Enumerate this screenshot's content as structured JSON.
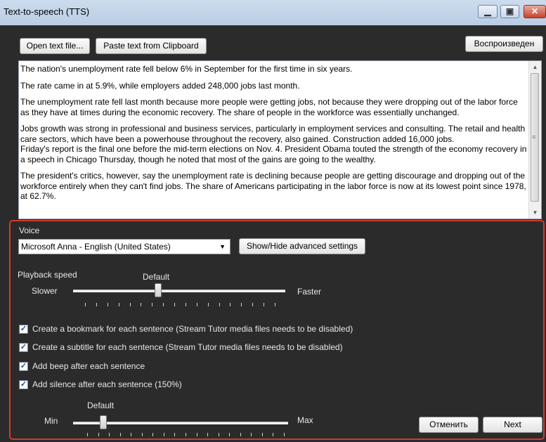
{
  "window": {
    "title": "Text-to-speech (TTS)",
    "min_glyph": "▁",
    "max_glyph": "▣",
    "close_glyph": "✕"
  },
  "toolbar": {
    "open_label": "Open text file...",
    "paste_label": "Paste text from Clipboard",
    "play_label": "Воспроизведен"
  },
  "text": {
    "paragraphs": [
      "The nation's unemployment rate fell below 6% in September for the first time in six years.",
      "The rate came in at 5.9%, while employers added 248,000 jobs last month.",
      "The unemployment rate fell last month because more people were getting jobs, not because they were dropping out of the labor force as they have at times during the economic recovery. The share of people in the workforce was essentially unchanged.",
      "Jobs growth was strong in professional and business services, particularly in employment services and consulting. The retail and health care sectors, which have been a powerhouse throughout the recovery, also gained. Construction added 16,000 jobs.",
      "Friday's report is the final one before the mid-term elections on Nov. 4. President Obama touted the strength of the economy recovery in a speech in Chicago Thursday, though he noted that most of the gains are going to the wealthy.",
      "The president's critics, however, say the unemployment rate is declining because people are getting discourage and dropping out of the workforce entirely when they can't find jobs. The share of Americans participating in the labor force is now at its lowest point since 1978, at 62.7%."
    ]
  },
  "voice": {
    "label": "Voice",
    "selected": "Microsoft Anna - English (United States)",
    "showhide_label": "Show/Hide advanced settings"
  },
  "speed": {
    "label": "Playback speed",
    "default_label": "Default",
    "min_label": "Slower",
    "max_label": "Faster",
    "value_fraction": 0.4
  },
  "options": [
    {
      "label": "Create a bookmark for each sentence (Stream Tutor media files needs to be disabled)",
      "checked": true
    },
    {
      "label": "Create a subtitle for each sentence (Stream Tutor media files needs to be disabled)",
      "checked": true
    },
    {
      "label": "Add beep after each sentence",
      "checked": true
    },
    {
      "label": "Add silence after each sentence (150%)",
      "checked": true
    }
  ],
  "silence": {
    "default_label": "Default",
    "min_label": "Min",
    "max_label": "Max",
    "value_fraction": 0.14
  },
  "footer": {
    "cancel_label": "Отменить",
    "next_label": "Next"
  },
  "check_glyph": "✓"
}
